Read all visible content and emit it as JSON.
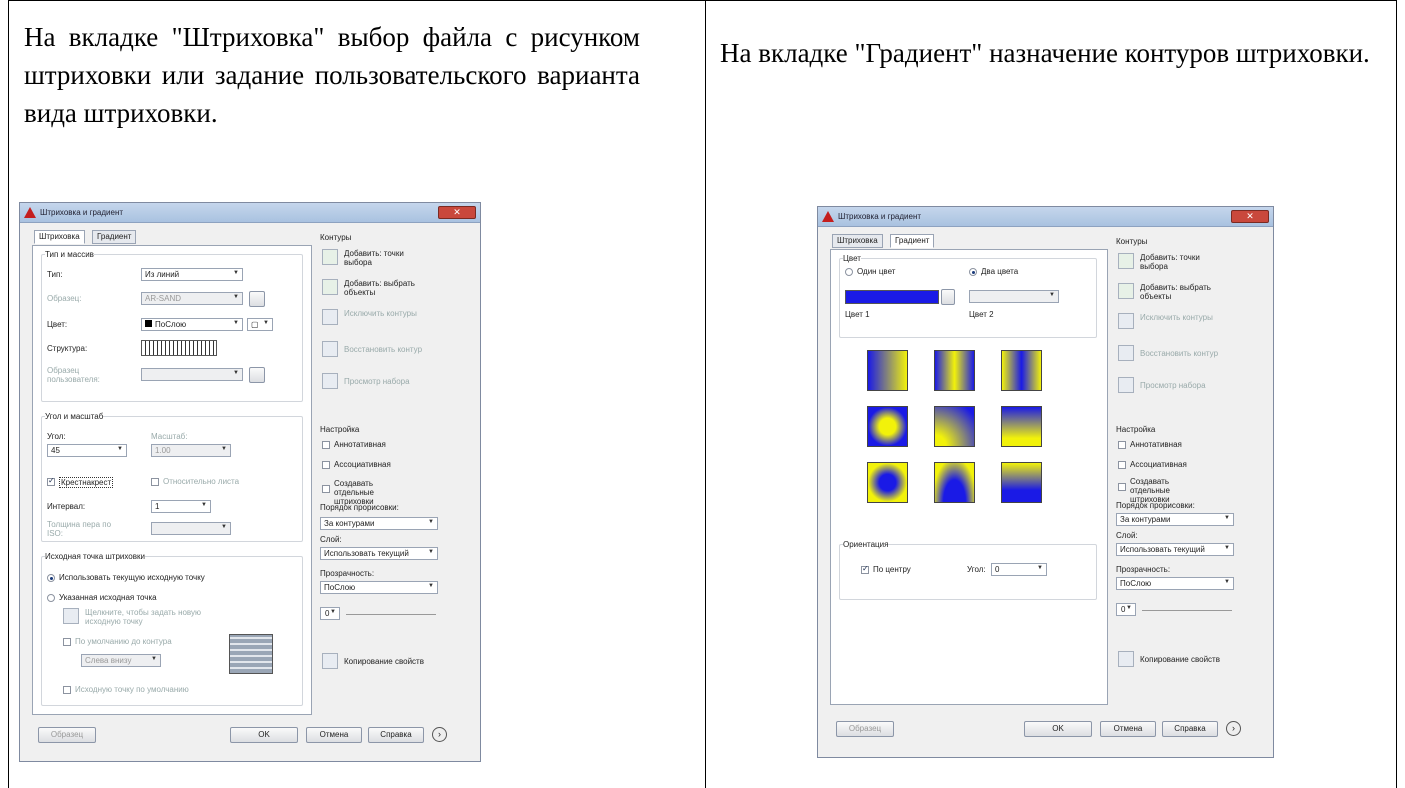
{
  "left": {
    "text": "На вкладке \"Штриховка\" выбор файла с рисунком штриховки или задание пользовательского варианта вида штриховки.",
    "dialog": {
      "title": "Штриховка и градиент",
      "tab_hatch": "Штриховка",
      "tab_gradient": "Градиент",
      "group_type": "Тип и массив",
      "type_label": "Тип:",
      "type_value": "Из линий",
      "pattern_label": "Образец:",
      "pattern_value": "AR-SAND",
      "color_label": "Цвет:",
      "color_value": "ПоСлою",
      "structure_label": "Структура:",
      "custom_label": "Образец пользователя:",
      "group_angle": "Угол и масштаб",
      "angle_label": "Угол:",
      "angle_value": "45",
      "scale_label": "Масштаб:",
      "scale_value": "1.00",
      "cross_label": "Крестнакрест",
      "relative_label": "Относительно листа",
      "interval_label": "Интервал:",
      "interval_value": "1",
      "pen_label": "Толщина пера по ISO:",
      "group_origin": "Исходная точка штриховки",
      "use_current_label": "Использовать текущую исходную точку",
      "specified_label": "Указанная исходная точка",
      "click_to_set_label": "Щелкните, чтобы задать новую исходную точку",
      "default_to_boundary_label": "По умолчанию до контура",
      "bottom_left_value": "Слева внизу",
      "store_default_label": "Исходную точку по умолчанию",
      "preview_btn": "Образец",
      "ok_btn": "OK",
      "cancel_btn": "Отмена",
      "help_btn": "Справка"
    }
  },
  "right": {
    "text": "На вкладке \"Градиент\" назначение контуров штриховки.",
    "dialog": {
      "title": "Штриховка и градиент",
      "tab_hatch": "Штриховка",
      "tab_gradient": "Градиент",
      "group_color": "Цвет",
      "one_color_label": "Один цвет",
      "two_color_label": "Два цвета",
      "color1_label": "Цвет 1",
      "color2_label": "Цвет 2",
      "orientation_label": "Ориентация",
      "centered_label": "По центру",
      "angle_label": "Угол:",
      "angle_value": "0",
      "preview_btn": "Образец",
      "ok_btn": "OK",
      "cancel_btn": "Отмена",
      "help_btn": "Справка"
    }
  },
  "side": {
    "contours": "Контуры",
    "add_pick": "Добавить: точки выбора",
    "add_select": "Добавить: выбрать объекты",
    "remove": "Исключить контуры",
    "recreate": "Восстановить контур",
    "view": "Просмотр набора",
    "options": "Настройка",
    "annotative": "Аннотативная",
    "associative": "Ассоциативная",
    "separate": "Создавать отдельные штриховки",
    "draw_order": "Порядок прорисовки:",
    "draw_order_value": "За контурами",
    "layer": "Слой:",
    "layer_value": "Использовать текущий",
    "transparency": "Прозрачность:",
    "transparency_value": "ПоСлою",
    "trans_number": "0",
    "inherit": "Копирование свойств"
  },
  "colors": {
    "gradient_a": "#1a1ae6",
    "gradient_b": "#f2f20a"
  }
}
